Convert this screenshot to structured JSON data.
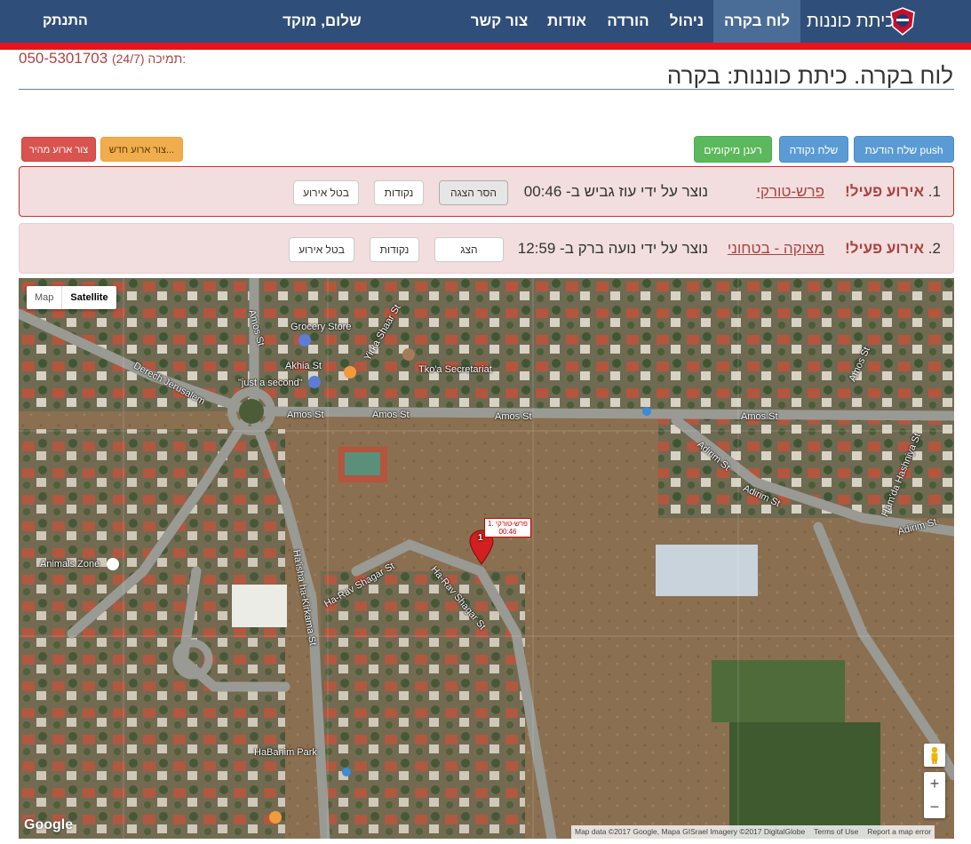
{
  "nav": {
    "brand": "כיתת כוננות",
    "items": [
      "לוח בקרה",
      "ניהול",
      "הורדה",
      "אודות",
      "צור קשר"
    ],
    "hello": "שלום, מוקד",
    "logout": "התנתק"
  },
  "header": {
    "support_label": "תמיכה (24/7):",
    "support_phone": "050-5301703",
    "title": "לוח בקרה.  כיתת כוננות:  בקרה"
  },
  "buttons": {
    "quick_event": "צור ארוע מהיר",
    "new_event": "צור ארוע חדש...",
    "refresh_locations": "רענן מיקומים",
    "send_point": "שלח נקודה",
    "send_push": "שלח הודעת push"
  },
  "events": [
    {
      "index": "1.",
      "status": "אירוע פעיל!",
      "name": "פרש-טורקי",
      "created": "נוצר על ידי עוז גביש ב- 00:46",
      "btn_show": "הסר הצגה",
      "btn_points": "נקודות",
      "btn_cancel": "בטל אירוע"
    },
    {
      "index": "2.",
      "status": "אירוע פעיל!",
      "name": "מצוקה - בטחוני",
      "created": "נוצר על ידי נועה ברק ב- 12:59",
      "btn_show": "הצג",
      "btn_points": "נקודות",
      "btn_cancel": "בטל אירוע"
    }
  ],
  "map": {
    "type_map": "Map",
    "type_satellite": "Satellite",
    "labels": {
      "grocery": "Grocery Store",
      "akhia": "Akhia St",
      "just_a_second": "\"just a second\"",
      "tkoa": "Tko'a Secretariat",
      "derech": "Derech Jerusalem",
      "amos1": "Amos St",
      "amos2": "Amos St",
      "amos3": "Amos St",
      "amos4": "Amos St",
      "amos5": "Amos St",
      "amos6": "Amos St",
      "yirka": "Yirka Shaar St",
      "adirim1": "Adirim St",
      "adirim2": "Adirim St",
      "adirim3": "Adirim St",
      "hamida": "Ham'da Hashniya St",
      "animals": "Animals Zone",
      "rav1": "Ha-Rav Shagar St",
      "rav2": "Ha-Rav Shagar St",
      "haisha": "Ha'isha ha-Kirkama St",
      "habanim": "HaBanim Park"
    },
    "marker_name": "1. פרש-טורקי",
    "marker_time": "00:46",
    "marker_num": "1",
    "google": "Google",
    "attribution": "Map data ©2017 Google, Mapa GISrael Imagery ©2017 DigitalGlobe",
    "terms": "Terms of Use",
    "report": "Report a map error",
    "zoom_in": "+",
    "zoom_out": "−"
  }
}
